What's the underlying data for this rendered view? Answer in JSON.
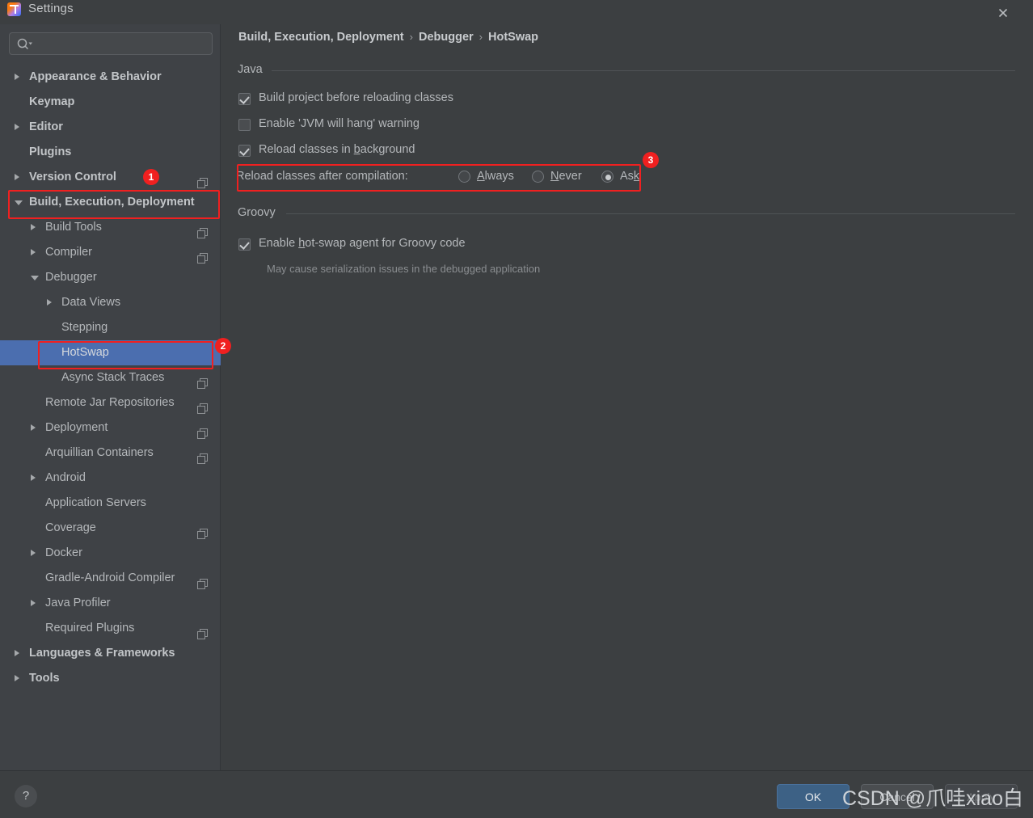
{
  "window": {
    "title": "Settings",
    "app_icon": "intellij-idea-icon",
    "close_icon": "close-icon"
  },
  "search": {
    "placeholder": "",
    "value": "",
    "icon": "search-icon"
  },
  "sidebar": {
    "items": [
      {
        "label": "Appearance & Behavior",
        "indent": 0,
        "arrow": "collapsed",
        "bold": true,
        "copy": false
      },
      {
        "label": "Keymap",
        "indent": 0,
        "arrow": "none",
        "bold": true,
        "copy": false
      },
      {
        "label": "Editor",
        "indent": 0,
        "arrow": "collapsed",
        "bold": true,
        "copy": false
      },
      {
        "label": "Plugins",
        "indent": 0,
        "arrow": "none",
        "bold": true,
        "copy": false
      },
      {
        "label": "Version Control",
        "indent": 0,
        "arrow": "collapsed",
        "bold": true,
        "copy": true
      },
      {
        "label": "Build, Execution, Deployment",
        "indent": 0,
        "arrow": "expanded",
        "bold": true,
        "copy": false
      },
      {
        "label": "Build Tools",
        "indent": 1,
        "arrow": "collapsed",
        "bold": false,
        "copy": true
      },
      {
        "label": "Compiler",
        "indent": 1,
        "arrow": "collapsed",
        "bold": false,
        "copy": true
      },
      {
        "label": "Debugger",
        "indent": 1,
        "arrow": "expanded",
        "bold": false,
        "copy": false
      },
      {
        "label": "Data Views",
        "indent": 2,
        "arrow": "collapsed",
        "bold": false,
        "copy": false
      },
      {
        "label": "Stepping",
        "indent": 2,
        "arrow": "none",
        "bold": false,
        "copy": false
      },
      {
        "label": "HotSwap",
        "indent": 2,
        "arrow": "none",
        "bold": false,
        "copy": false,
        "selected": true
      },
      {
        "label": "Async Stack Traces",
        "indent": 2,
        "arrow": "none",
        "bold": false,
        "copy": true
      },
      {
        "label": "Remote Jar Repositories",
        "indent": 1,
        "arrow": "none",
        "bold": false,
        "copy": true
      },
      {
        "label": "Deployment",
        "indent": 1,
        "arrow": "collapsed",
        "bold": false,
        "copy": true
      },
      {
        "label": "Arquillian Containers",
        "indent": 1,
        "arrow": "none",
        "bold": false,
        "copy": true
      },
      {
        "label": "Android",
        "indent": 1,
        "arrow": "collapsed",
        "bold": false,
        "copy": false
      },
      {
        "label": "Application Servers",
        "indent": 1,
        "arrow": "none",
        "bold": false,
        "copy": false
      },
      {
        "label": "Coverage",
        "indent": 1,
        "arrow": "none",
        "bold": false,
        "copy": true
      },
      {
        "label": "Docker",
        "indent": 1,
        "arrow": "collapsed",
        "bold": false,
        "copy": false
      },
      {
        "label": "Gradle-Android Compiler",
        "indent": 1,
        "arrow": "none",
        "bold": false,
        "copy": true
      },
      {
        "label": "Java Profiler",
        "indent": 1,
        "arrow": "collapsed",
        "bold": false,
        "copy": false
      },
      {
        "label": "Required Plugins",
        "indent": 1,
        "arrow": "none",
        "bold": false,
        "copy": true
      },
      {
        "label": "Languages & Frameworks",
        "indent": 0,
        "arrow": "collapsed",
        "bold": true,
        "copy": false
      },
      {
        "label": "Tools",
        "indent": 0,
        "arrow": "collapsed",
        "bold": true,
        "copy": false
      }
    ]
  },
  "breadcrumb": {
    "part1": "Build, Execution, Deployment",
    "sep1": "›",
    "part2": "Debugger",
    "sep2": "›",
    "part3": "HotSwap"
  },
  "java_group": {
    "title": "Java",
    "options": [
      {
        "label": "Build project before reloading classes",
        "checked": true
      },
      {
        "label": "Enable 'JVM will hang' warning",
        "checked": false
      },
      {
        "label": "Reload classes in ",
        "mnemonic": "b",
        "label_tail": "ackground",
        "checked": true
      }
    ],
    "reload_after_compilation": {
      "label": "Reload classes after compilation:",
      "selected": "Ask",
      "choices": [
        {
          "label_head": "",
          "mnemonic": "A",
          "label_tail": "lways",
          "selected": false
        },
        {
          "label_head": "",
          "mnemonic": "N",
          "label_tail": "ever",
          "selected": false
        },
        {
          "label_head": "As",
          "mnemonic": "k",
          "label_tail": "",
          "selected": true
        }
      ]
    }
  },
  "groovy_group": {
    "title": "Groovy",
    "option": {
      "label_head": "Enable ",
      "mnemonic": "h",
      "label_tail": "ot-swap agent for Groovy code",
      "checked": true
    },
    "hint": "May cause serialization issues in the debugged application"
  },
  "footer": {
    "help_label": "?",
    "ok_label": "OK",
    "cancel_label": "Cancel",
    "apply_label": "Apply"
  },
  "annotations": {
    "badge1": "1",
    "badge2": "2",
    "badge3": "3",
    "color": "#f02020"
  },
  "watermark": "CSDN @爪哇xiao白"
}
